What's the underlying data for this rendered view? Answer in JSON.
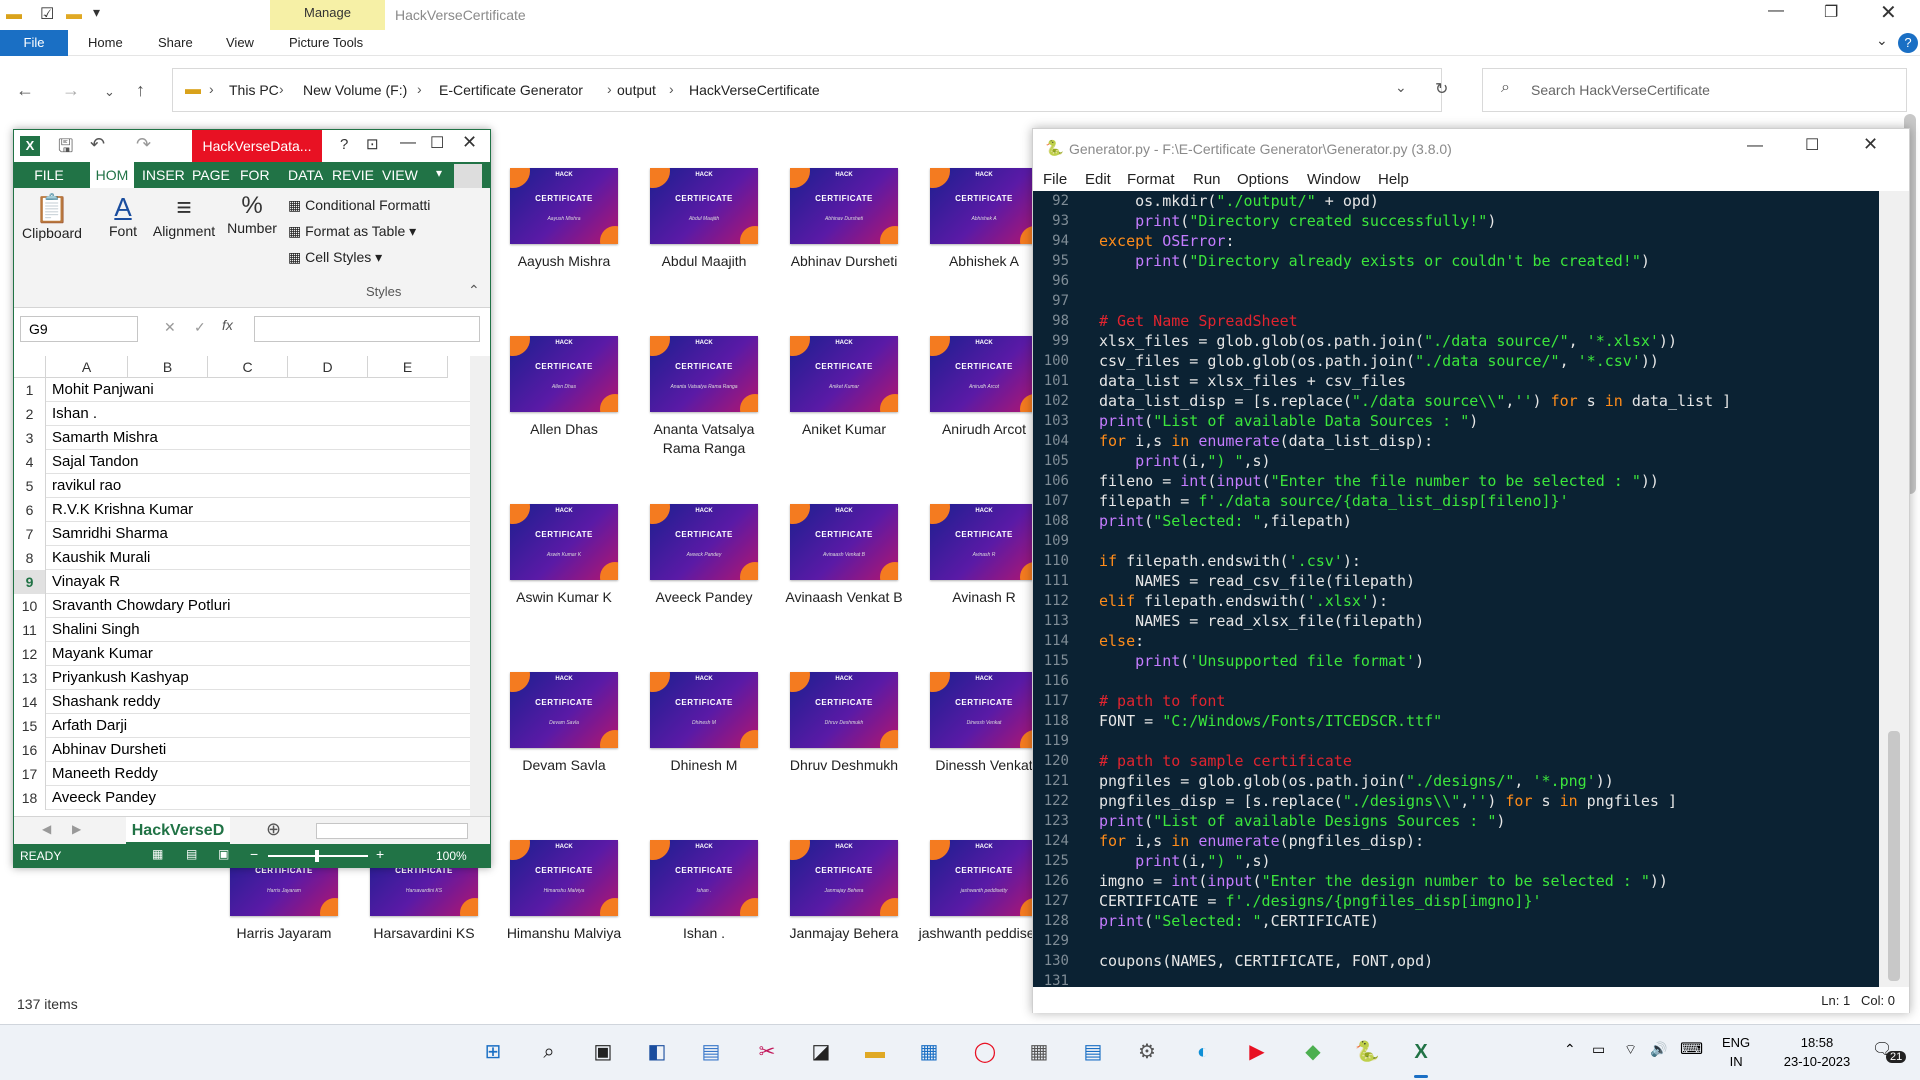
{
  "explorer": {
    "title": "HackVerseCertificate",
    "context_tab": "Manage",
    "tabs": [
      "File",
      "Home",
      "Share",
      "View",
      "Picture Tools"
    ],
    "breadcrumb": [
      "This PC",
      "New Volume (F:)",
      "E-Certificate Generator",
      "output",
      "HackVerseCertificate"
    ],
    "search_placeholder": "Search HackVerseCertificate",
    "status": "137 items",
    "thumb_title": "CERTIFICATE",
    "thumb_logo": "HACK",
    "files": [
      [
        "Aayush Mishra",
        "Abdul Maajith",
        "Abhinav Dursheti",
        "Abhishek A"
      ],
      [
        "Allen Dhas",
        "Ananta Vatsalya Rama Ranga",
        "Aniket Kumar",
        "Anirudh Arcot"
      ],
      [
        "Aswin Kumar K",
        "Aveeck Pandey",
        "Avinaash Venkat B",
        "Avinash R"
      ],
      [
        "Devam Savla",
        "Dhinesh M",
        "Dhruv Deshmukh",
        "Dinessh Venkat"
      ],
      [
        "Harris Jayaram",
        "Harsavardini KS",
        "Himanshu Malviya",
        "Ishan .",
        "Janmajay Behera",
        "jashwanth peddisetty"
      ]
    ]
  },
  "excel": {
    "title": "HackVerseData...",
    "tabs": [
      "FILE",
      "HOM",
      "INSER",
      "PAGE",
      "FOR",
      "DATA",
      "REVIE",
      "VIEW"
    ],
    "groups": {
      "clipboard": "Clipboard",
      "font": "Font",
      "alignment": "Alignment",
      "number": "Number",
      "styles": "Styles"
    },
    "styles_items": [
      "Conditional Formatti",
      "Format as Table",
      "Cell Styles"
    ],
    "name_box": "G9",
    "columns": [
      "A",
      "B",
      "C",
      "D",
      "E"
    ],
    "rows": [
      [
        "1",
        "Mohit Panjwani"
      ],
      [
        "2",
        "Ishan ."
      ],
      [
        "3",
        "Samarth Mishra"
      ],
      [
        "4",
        "Sajal Tandon"
      ],
      [
        "5",
        "ravikul rao"
      ],
      [
        "6",
        "R.V.K  Krishna Kumar"
      ],
      [
        "7",
        "Samridhi Sharma"
      ],
      [
        "8",
        "Kaushik Murali"
      ],
      [
        "9",
        "Vinayak R"
      ],
      [
        "10",
        "Sravanth Chowdary Potluri"
      ],
      [
        "11",
        "Shalini Singh"
      ],
      [
        "12",
        "Mayank Kumar"
      ],
      [
        "13",
        "Priyankush Kashyap"
      ],
      [
        "14",
        "Shashank reddy"
      ],
      [
        "15",
        "Arfath Darji"
      ],
      [
        "16",
        "Abhinav Dursheti"
      ],
      [
        "17",
        "Maneeth Reddy"
      ],
      [
        "18",
        "Aveeck Pandey"
      ]
    ],
    "sheet_tab": "HackVerseD",
    "status": "READY",
    "zoom": "100%"
  },
  "idle": {
    "title": "Generator.py - F:\\E-Certificate Generator\\Generator.py (3.8.0)",
    "menu": [
      "File",
      "Edit",
      "Format",
      "Run",
      "Options",
      "Window",
      "Help"
    ],
    "status": "Ln: 1   Col: 0",
    "line_numbers": [
      "92",
      "93",
      "94",
      "95",
      "96",
      "97",
      "98",
      "99",
      "100",
      "101",
      "102",
      "103",
      "104",
      "105",
      "106",
      "107",
      "108",
      "109",
      "110",
      "111",
      "112",
      "113",
      "114",
      "115",
      "116",
      "117",
      "118",
      "119",
      "120",
      "121",
      "122",
      "123",
      "124",
      "125",
      "126",
      "127",
      "128",
      "129",
      "130",
      "131"
    ]
  },
  "taskbar": {
    "lang1": "ENG",
    "lang2": "IN",
    "time": "18:58",
    "date": "23-10-2023",
    "notif": "21"
  },
  "colors": {
    "excel_green": "#217346",
    "idle_bg": "#0b2233",
    "keyword": "#ff8c1a",
    "string": "#3ce63c",
    "builtin": "#c57cff",
    "comment": "#e0242f",
    "windows_blue": "#1a6fc4"
  }
}
